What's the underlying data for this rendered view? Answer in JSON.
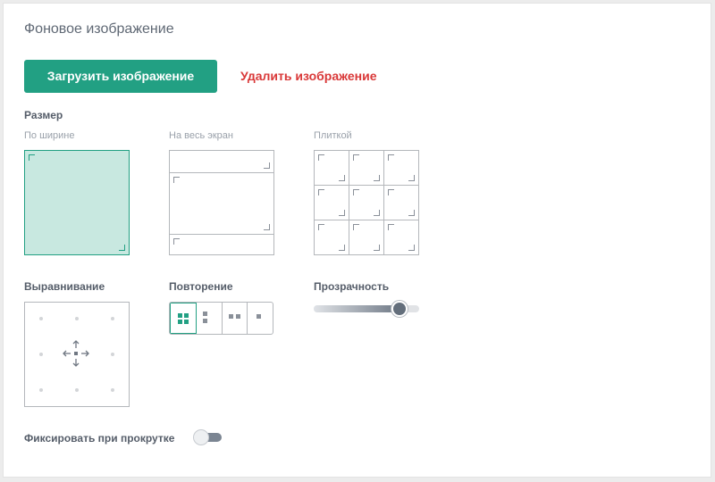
{
  "panel": {
    "title": "Фоновое изображение"
  },
  "actions": {
    "upload_label": "Загрузить изображение",
    "delete_label": "Удалить изображение"
  },
  "size": {
    "label": "Размер",
    "options": [
      {
        "label": "По ширине",
        "selected": true
      },
      {
        "label": "На весь экран",
        "selected": false
      },
      {
        "label": "Плиткой",
        "selected": false
      }
    ]
  },
  "alignment": {
    "label": "Выравнивание",
    "selected": "center"
  },
  "repeat": {
    "label": "Повторение",
    "options": [
      "repeat-both",
      "repeat-vertical",
      "repeat-horizontal",
      "no-repeat"
    ],
    "selected": "repeat-both"
  },
  "opacity": {
    "label": "Прозрачность",
    "value_fraction": 0.81
  },
  "fixed_scroll": {
    "label": "Фиксировать при прокрутке",
    "enabled": false
  },
  "colors": {
    "accent": "#22a083",
    "danger": "#d93838",
    "text": "#555d69",
    "muted": "#9aa1aa",
    "border": "#b4b7bb",
    "selected_fill": "#c8e8e0"
  }
}
